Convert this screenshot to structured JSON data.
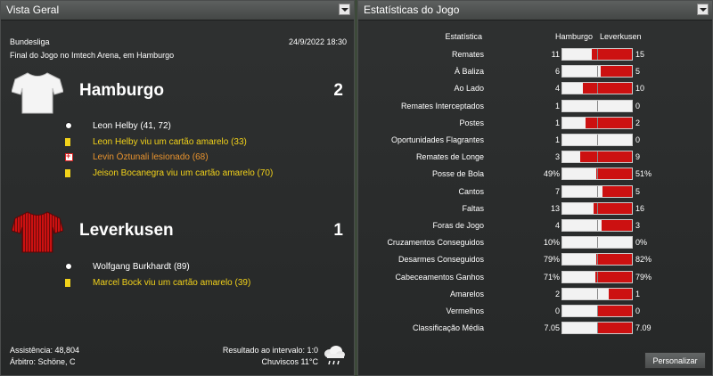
{
  "overview": {
    "title": "Vista Geral",
    "competition": "Bundesliga",
    "datetime": "24/9/2022 18:30",
    "venue": "Final do Jogo no Imtech Arena, em Hamburgo",
    "home": {
      "name": "Hamburgo",
      "score": "2",
      "kit_color": "#f4f4f4",
      "events": [
        {
          "icon": "ball-icon",
          "text": "Leon Helby (41, 72)",
          "color": "#ffffff"
        },
        {
          "icon": "yellow-card-icon",
          "text": "Leon Helby viu um cartão amarelo (33)",
          "color": "#f2d21a"
        },
        {
          "icon": "injury-icon",
          "text": "Levin Öztunali lesionado (68)",
          "color": "#e8932e"
        },
        {
          "icon": "yellow-card-icon",
          "text": "Jeison Bocanegra viu um cartão amarelo (70)",
          "color": "#f2d21a"
        }
      ]
    },
    "away": {
      "name": "Leverkusen",
      "score": "1",
      "kit_color": "#cc1111",
      "events": [
        {
          "icon": "ball-icon",
          "text": "Wolfgang Burkhardt (89)",
          "color": "#ffffff"
        },
        {
          "icon": "yellow-card-icon",
          "text": "Marcel Bock viu um cartão amarelo (39)",
          "color": "#f2d21a"
        }
      ]
    },
    "attendance": "Assistência: 48,804",
    "referee": "Árbitro: Schöne, C",
    "halftime": "Resultado ao intervalo: 1:0",
    "weather": "Chuviscos 11°C"
  },
  "stats": {
    "title": "Estatísticas do Jogo",
    "col_stat": "Estatística",
    "col_home": "Hamburgo",
    "col_away": "Leverkusen",
    "button_label": "Personalizar",
    "rows": [
      {
        "label": "Remates",
        "home": "11",
        "away": "15",
        "home_share": 0.42
      },
      {
        "label": "À Baliza",
        "home": "6",
        "away": "5",
        "home_share": 0.55
      },
      {
        "label": "Ao Lado",
        "home": "4",
        "away": "10",
        "home_share": 0.29
      },
      {
        "label": "Remates Interceptados",
        "home": "1",
        "away": "0",
        "home_share": 1.0
      },
      {
        "label": "Postes",
        "home": "1",
        "away": "2",
        "home_share": 0.33
      },
      {
        "label": "Oportunidades Flagrantes",
        "home": "1",
        "away": "0",
        "home_share": 1.0
      },
      {
        "label": "Remates de Longe",
        "home": "3",
        "away": "9",
        "home_share": 0.25
      },
      {
        "label": "Posse de Bola",
        "home": "49%",
        "away": "51%",
        "home_share": 0.49
      },
      {
        "label": "Cantos",
        "home": "7",
        "away": "5",
        "home_share": 0.58
      },
      {
        "label": "Faltas",
        "home": "13",
        "away": "16",
        "home_share": 0.45
      },
      {
        "label": "Foras de Jogo",
        "home": "4",
        "away": "3",
        "home_share": 0.57
      },
      {
        "label": "Cruzamentos Conseguidos",
        "home": "10%",
        "away": "0%",
        "home_share": 1.0
      },
      {
        "label": "Desarmes Conseguidos",
        "home": "79%",
        "away": "82%",
        "home_share": 0.49
      },
      {
        "label": "Cabeceamentos Ganhos",
        "home": "71%",
        "away": "79%",
        "home_share": 0.47
      },
      {
        "label": "Amarelos",
        "home": "2",
        "away": "1",
        "home_share": 0.67
      },
      {
        "label": "Vermelhos",
        "home": "0",
        "away": "0",
        "home_share": 0.5
      },
      {
        "label": "Classificação Média",
        "home": "7.05",
        "away": "7.09",
        "home_share": 0.5
      }
    ]
  }
}
